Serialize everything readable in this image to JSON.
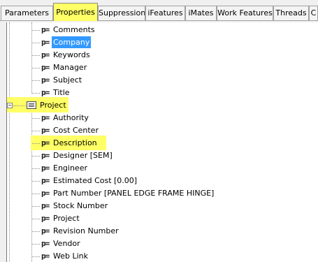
{
  "tabs": [
    {
      "label": "Parameters",
      "active": false
    },
    {
      "label": "Properties",
      "active": true
    },
    {
      "label": "Suppression",
      "active": false
    },
    {
      "label": "iFeatures",
      "active": false
    },
    {
      "label": "iMates",
      "active": false
    },
    {
      "label": "Work Features",
      "active": false
    },
    {
      "label": "Threads",
      "active": false
    },
    {
      "label": "C",
      "active": false
    }
  ],
  "property_icon": "p=",
  "tree": {
    "summary_items": [
      {
        "label": "Comments",
        "selected": false
      },
      {
        "label": "Company",
        "selected": true
      },
      {
        "label": "Keywords",
        "selected": false
      },
      {
        "label": "Manager",
        "selected": false
      },
      {
        "label": "Subject",
        "selected": false
      },
      {
        "label": "Title",
        "selected": false
      }
    ],
    "project_group": {
      "label": "Project",
      "expander": "−",
      "expanded": true,
      "icon": "property-group-icon",
      "highlight_color": "#ffff66"
    },
    "project_items": [
      {
        "label": "Authority"
      },
      {
        "label": "Cost Center"
      },
      {
        "label": "Description",
        "highlighted": true
      },
      {
        "label": "Designer [SEM]"
      },
      {
        "label": "Engineer"
      },
      {
        "label": "Estimated Cost [0.00]"
      },
      {
        "label": "Part Number [PANEL EDGE FRAME HINGE]"
      },
      {
        "label": "Stock Number"
      },
      {
        "label": "Project"
      },
      {
        "label": "Revision Number"
      },
      {
        "label": "Vendor"
      },
      {
        "label": "Web Link"
      }
    ]
  },
  "colors": {
    "highlight": "#ffff66",
    "selection": "#3399ff"
  }
}
